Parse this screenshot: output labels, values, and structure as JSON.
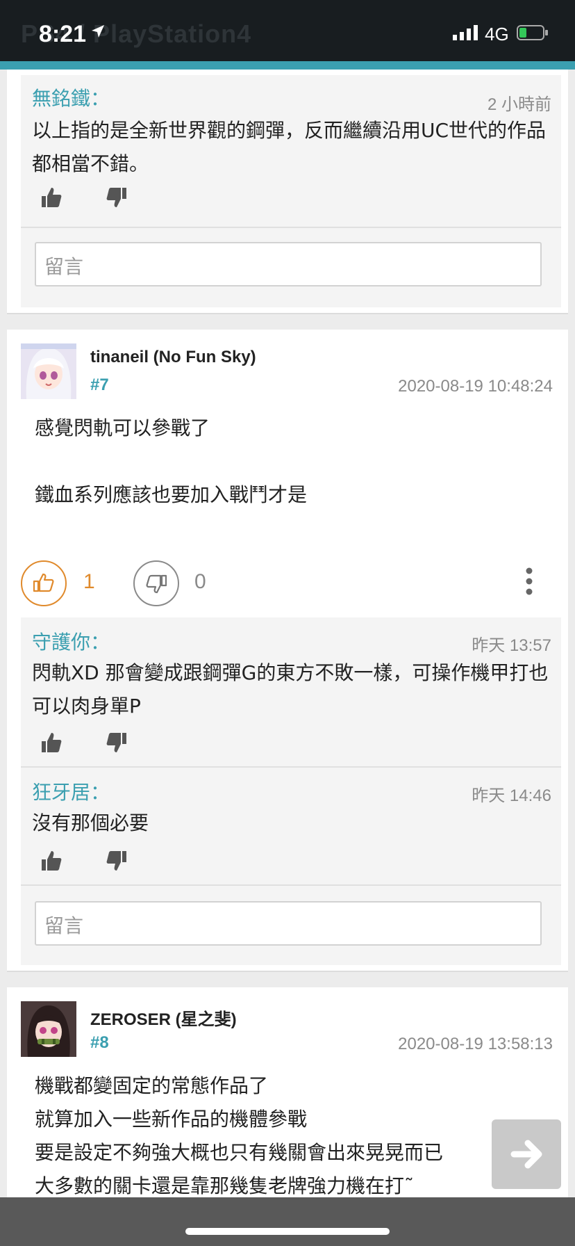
{
  "status_bar": {
    "time": "8:21",
    "background_title": "PS4 / PlayStation4",
    "network": "4G"
  },
  "thread_top": {
    "reply": {
      "author": "無銘鐵：",
      "time": "2 小時前",
      "text": "以上指的是全新世界觀的鋼彈，反而繼續沿用UC世代的作品都相當不錯。"
    },
    "comment_placeholder": "留言"
  },
  "posts": [
    {
      "username": "tinaneil (No Fun Sky)",
      "floor": "#7",
      "timestamp": "2020-08-19 10:48:24",
      "lines": [
        "感覺閃軌可以參戰了",
        "",
        "鐵血系列應該也要加入戰鬥才是"
      ],
      "likes": "1",
      "dislikes": "0",
      "replies": [
        {
          "author": "守護你：",
          "time": "昨天 13:57",
          "text": "閃軌XD 那會變成跟鋼彈G的東方不敗一樣，可操作機甲打也可以肉身單P"
        },
        {
          "author": "狂牙居：",
          "time": "昨天 14:46",
          "text": "沒有那個必要"
        }
      ],
      "comment_placeholder": "留言"
    },
    {
      "username": "ZEROSER (星之斐)",
      "floor": "#8",
      "timestamp": "2020-08-19 13:58:13",
      "lines": [
        "機戰都變固定的常態作品了",
        "就算加入一些新作品的機體參戰",
        "要是設定不夠強大概也只有幾關會出來晃晃而已",
        "大多數的關卡還是靠那幾隻老牌強力機在打˜"
      ]
    }
  ],
  "colors": {
    "accent": "#3b9fb0",
    "like": "#e08a2c",
    "status_bar": "#181d20"
  }
}
